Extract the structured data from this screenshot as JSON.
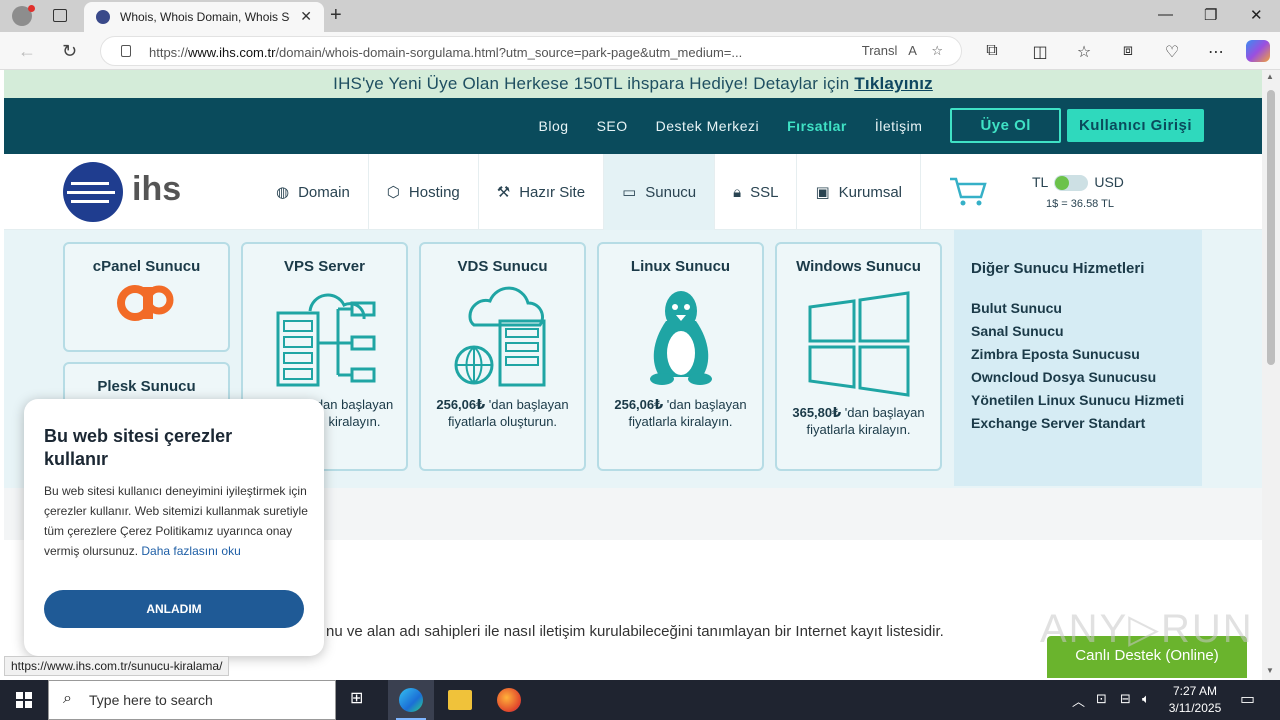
{
  "browser": {
    "tab_title": "Whois, Whois Domain, Whois Sorgulama",
    "url_prefix": "https://",
    "url_domain": "www.ihs.com.tr",
    "url_rest": "/domain/whois-domain-sorgulama.html?utm_source=park-page&utm_medium=...",
    "translate_label": "Transl",
    "status_url": "https://www.ihs.com.tr/sunucu-kiralama/"
  },
  "promo": {
    "text": "IHS'ye Yeni Üye Olan Herkese 150TL ihspara Hediye! Detaylar için",
    "link": "Tıklayınız"
  },
  "topnav": {
    "links": [
      "Blog",
      "SEO",
      "Destek Merkezi",
      "Fırsatlar",
      "İletişim"
    ],
    "register": "Üye Ol",
    "login": "Kullanıcı Girişi"
  },
  "logo": {
    "text": "ihs"
  },
  "menu": [
    {
      "label": "Domain",
      "icon": "globe-icon"
    },
    {
      "label": "Hosting",
      "icon": "box-icon"
    },
    {
      "label": "Hazır Site",
      "icon": "wand-icon"
    },
    {
      "label": "Sunucu",
      "icon": "server-icon"
    },
    {
      "label": "SSL",
      "icon": "lock-icon"
    },
    {
      "label": "Kurumsal",
      "icon": "briefcase-icon"
    }
  ],
  "currency": {
    "left": "TL",
    "right": "USD",
    "rate": "1$ = 36.58 TL"
  },
  "cards": {
    "cpanel": "cPanel Sunucu",
    "plesk": "Plesk Sunucu",
    "vps": {
      "title": "VPS Server",
      "desc": "dan başlayan kiralayın."
    },
    "vds": {
      "title": "VDS Sunucu",
      "price": "256,06₺",
      "desc": "'dan başlayan fiyatlarla oluşturun."
    },
    "linux": {
      "title": "Linux Sunucu",
      "price": "256,06₺",
      "desc": "'dan başlayan fiyatlarla kiralayın."
    },
    "windows": {
      "title": "Windows Sunucu",
      "price": "365,80₺",
      "desc": "'dan başlayan fiyatlarla kiralayın."
    }
  },
  "side": {
    "title": "Diğer Sunucu Hizmetleri",
    "items": [
      "Bulut Sunucu",
      "Sanal Sunucu",
      "Zimbra Eposta Sunucusu",
      "Owncloud Dosya Sunucusu",
      "Yönetilen Linux Sunucu Hizmeti",
      "Exchange Server Standart"
    ]
  },
  "body_text": "nu ve alan adı sahipleri ile nasıl iletişim kurulabileceğini tanımlayan bir Internet kayıt listesidir.",
  "support": "Canlı Destek (Online)",
  "cookie": {
    "title": "Bu web sitesi çerezler kullanır",
    "body": "Bu web sitesi kullanıcı deneyimini iyileştirmek için çerezler kullanır. Web sitemizi kullanmak suretiyle tüm çerezlere Çerez Politikamız uyarınca onay vermiş olursunuz.",
    "link": "Daha fazlasını oku",
    "button": "ANLADIM"
  },
  "taskbar": {
    "search_placeholder": "Type here to search",
    "time": "7:27 AM",
    "date": "3/11/2025"
  },
  "colors": {
    "brand": "#0a4b5c",
    "accent": "#2fd9bd",
    "support": "#6ab42d"
  }
}
